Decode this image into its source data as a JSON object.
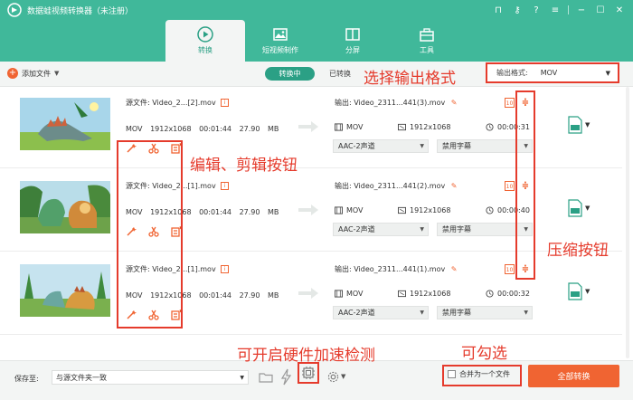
{
  "app": {
    "title": "数据蛙视频转换器（未注册）"
  },
  "nav": {
    "tabs": [
      {
        "label": "转换",
        "icon": "convert-icon"
      },
      {
        "label": "短视频制作",
        "icon": "image-icon"
      },
      {
        "label": "分屏",
        "icon": "split-screen-icon"
      },
      {
        "label": "工具",
        "icon": "toolbox-icon"
      }
    ],
    "active_tab": "转换"
  },
  "toolbar": {
    "add_file": "添加文件",
    "converting": "转换中",
    "converted": "已转换",
    "output_format_label": "输出格式:",
    "output_format_value": "MOV"
  },
  "files": [
    {
      "source_label": "源文件:",
      "source_name": "Video_2...[2].mov",
      "format": "MOV",
      "resolution": "1912x1068",
      "duration": "00:01:44",
      "size": "27.90 MB",
      "output_label": "输出:",
      "output_name": "Video_2311...441(3).mov",
      "out_format": "MOV",
      "out_resolution": "1912x1068",
      "out_duration": "00:00:31",
      "audio": "AAC-2声道",
      "subtitle": "禁用字幕"
    },
    {
      "source_label": "源文件:",
      "source_name": "Video_2...[1].mov",
      "format": "MOV",
      "resolution": "1912x1068",
      "duration": "00:01:44",
      "size": "27.90 MB",
      "output_label": "输出:",
      "output_name": "Video_2311...441(2).mov",
      "out_format": "MOV",
      "out_resolution": "1912x1068",
      "out_duration": "00:00:40",
      "audio": "AAC-2声道",
      "subtitle": "禁用字幕"
    },
    {
      "source_label": "源文件:",
      "source_name": "Video_2...[1].mov",
      "format": "MOV",
      "resolution": "1912x1068",
      "duration": "00:01:44",
      "size": "27.90 MB",
      "output_label": "输出:",
      "output_name": "Video_2311...441(1).mov",
      "out_format": "MOV",
      "out_resolution": "1912x1068",
      "out_duration": "00:00:32",
      "audio": "AAC-2声道",
      "subtitle": "禁用字幕"
    }
  ],
  "bottom": {
    "save_to_label": "保存至:",
    "save_to_value": "与源文件夹一致",
    "merge_label": "合并为一个文件",
    "convert_all": "全部转换"
  },
  "annotations": {
    "select_format": "选择输出格式",
    "edit_cut": "编辑、剪辑按钮",
    "compress": "压缩按钮",
    "hw_accel": "可开启硬件加速检测",
    "checkable": "可勾选"
  },
  "colors": {
    "brand_green": "#40b89a",
    "accent_orange": "#f06432",
    "annotation_red": "#e53b2c"
  }
}
